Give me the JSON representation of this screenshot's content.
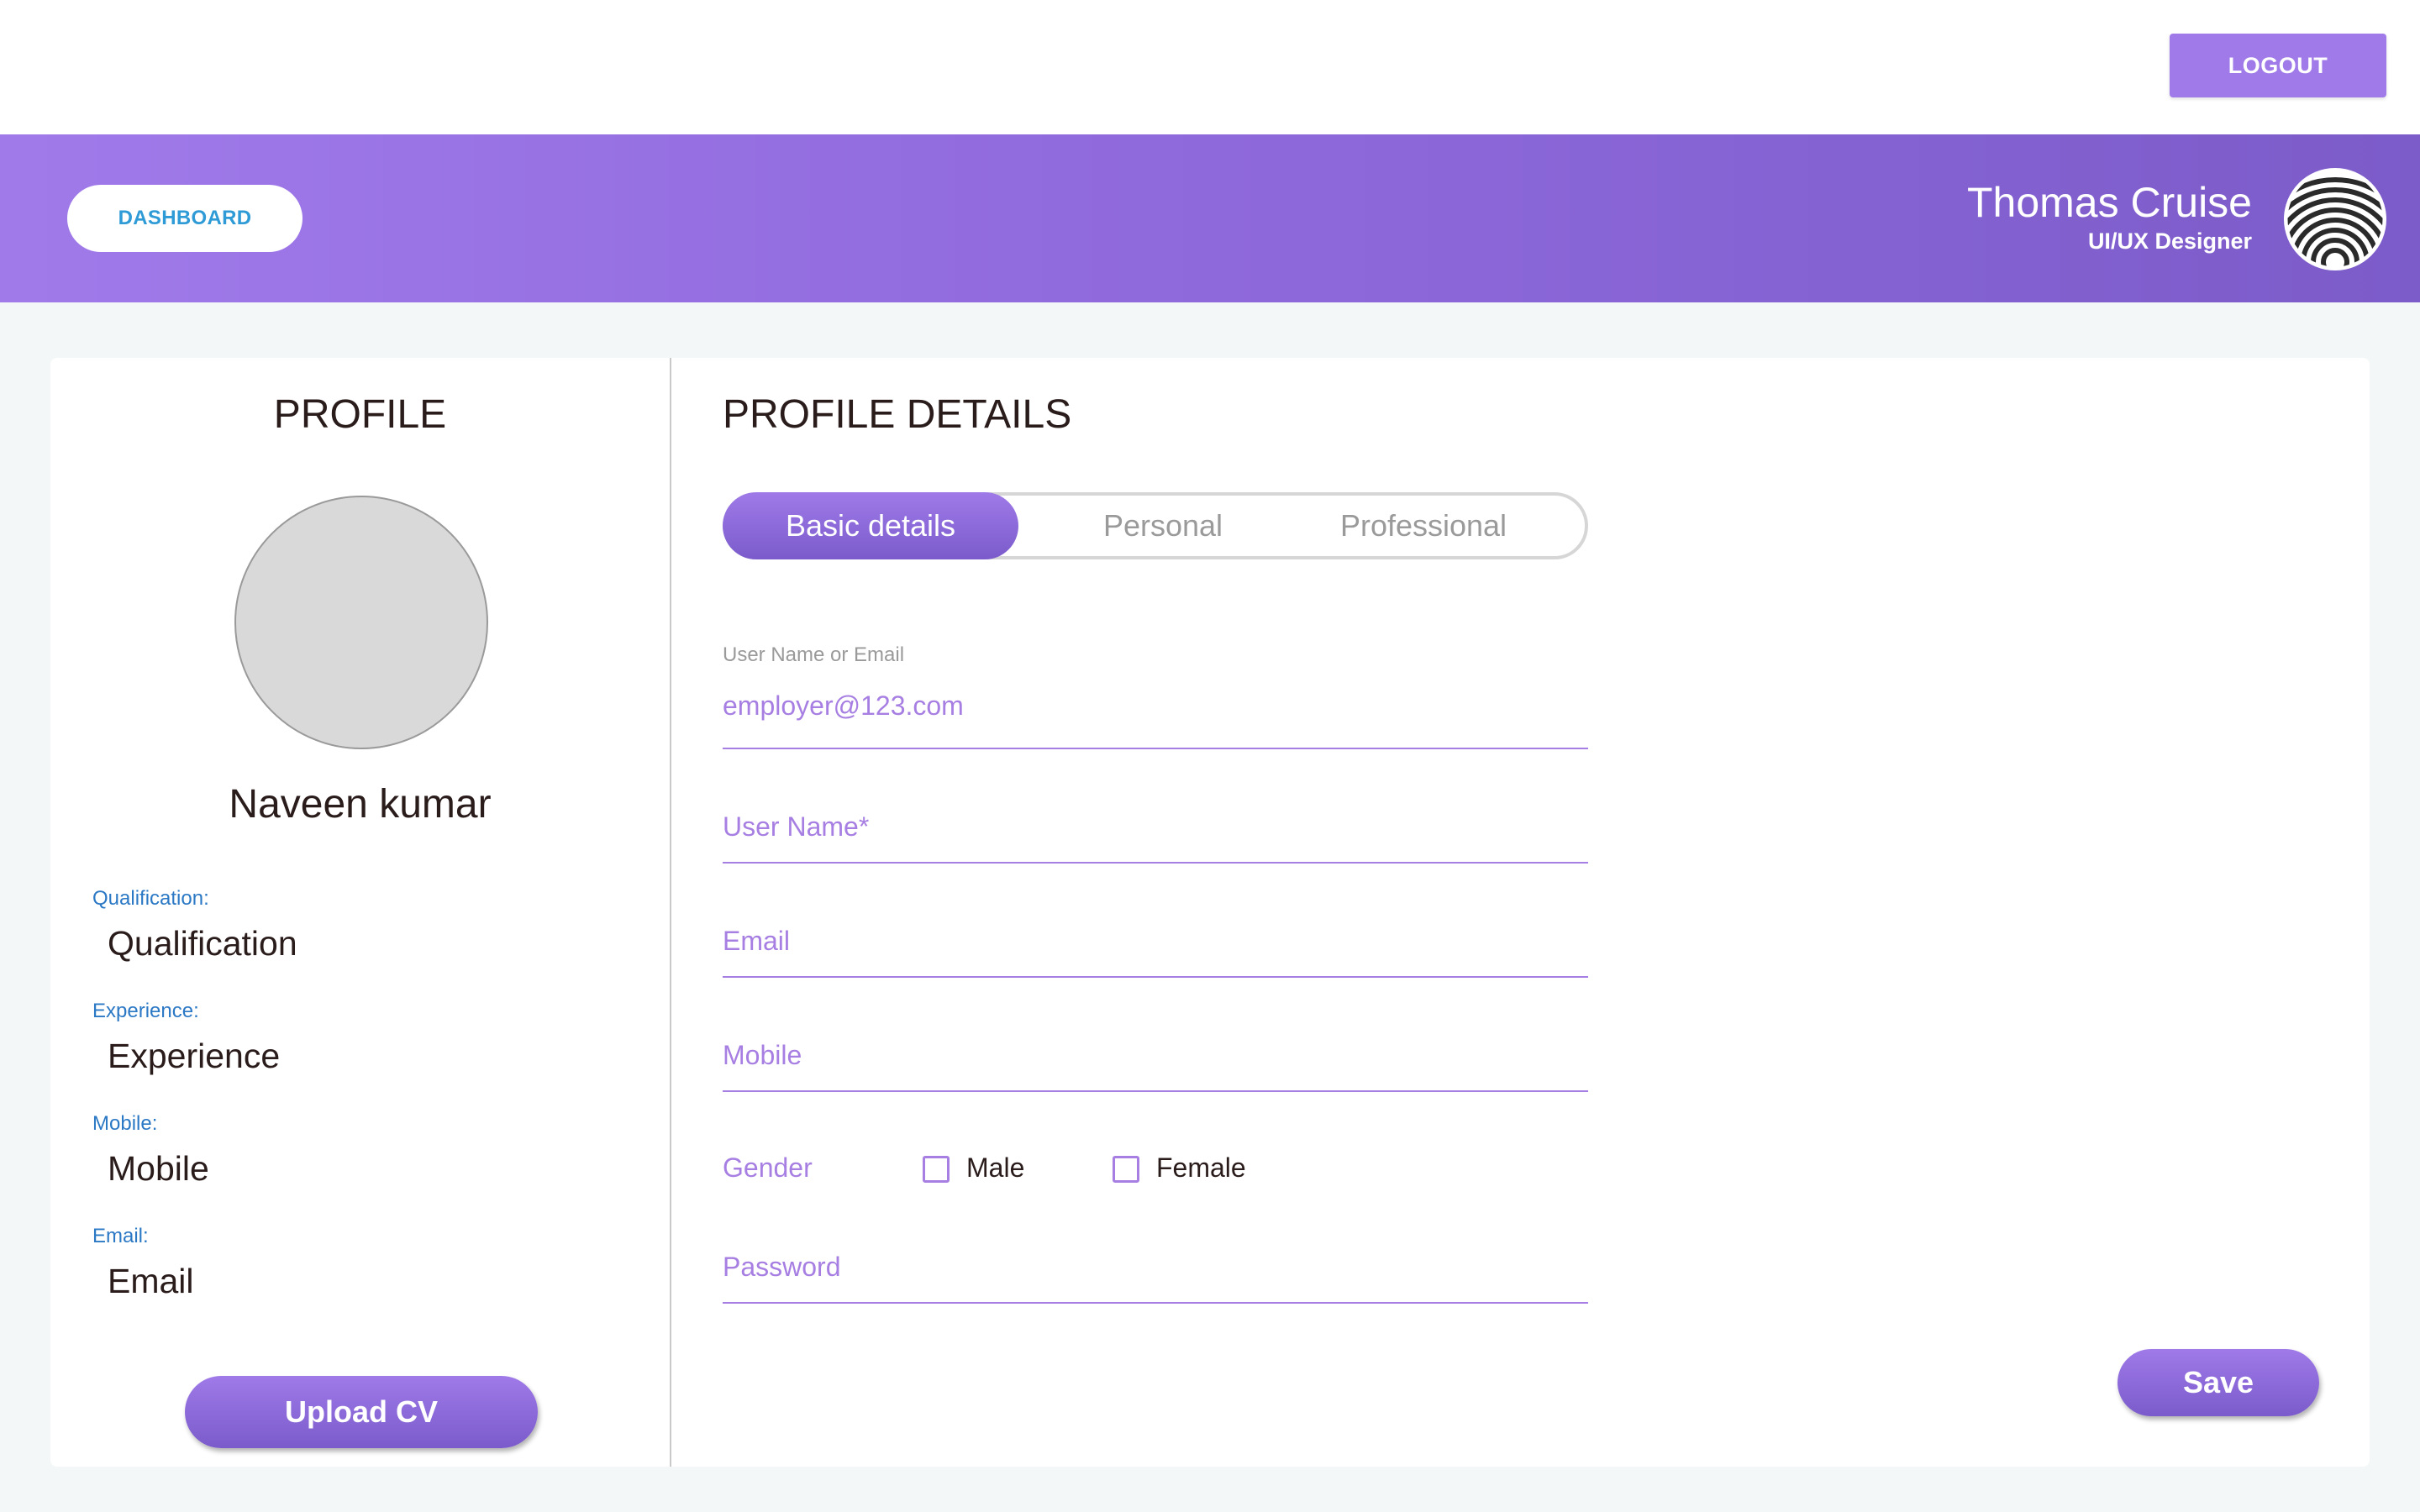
{
  "header": {
    "logout_label": "LOGOUT",
    "dashboard_label": "DASHBOARD",
    "user_name": "Thomas Cruise",
    "user_role": "UI/UX Designer",
    "avatar_icon": "wave-pattern-logo-icon"
  },
  "profile": {
    "title": "PROFILE",
    "name": "Naveen kumar",
    "fields": [
      {
        "label": "Qualification:",
        "value": "Qualification"
      },
      {
        "label": "Experience:",
        "value": "Experience"
      },
      {
        "label": "Mobile:",
        "value": "Mobile"
      },
      {
        "label": "Email:",
        "value": "Email"
      }
    ],
    "upload_label": "Upload CV"
  },
  "details": {
    "title": "PROFILE DETAILS",
    "tabs": [
      "Basic details",
      "Personal",
      "Professional"
    ],
    "active_tab": "Basic details",
    "username_or_email_label": "User Name or Email",
    "username_or_email_value": "employer@123.com",
    "username_placeholder": "User Name*",
    "email_placeholder": "Email",
    "mobile_placeholder": "Mobile",
    "gender_label": "Gender",
    "gender_options": [
      "Male",
      "Female"
    ],
    "password_placeholder": "Password",
    "save_label": "Save"
  },
  "colors": {
    "accent": "#9f7ae8",
    "accent_dark": "#7b5bcb",
    "link_blue": "#2f9bd6",
    "label_blue": "#2b78c5"
  }
}
